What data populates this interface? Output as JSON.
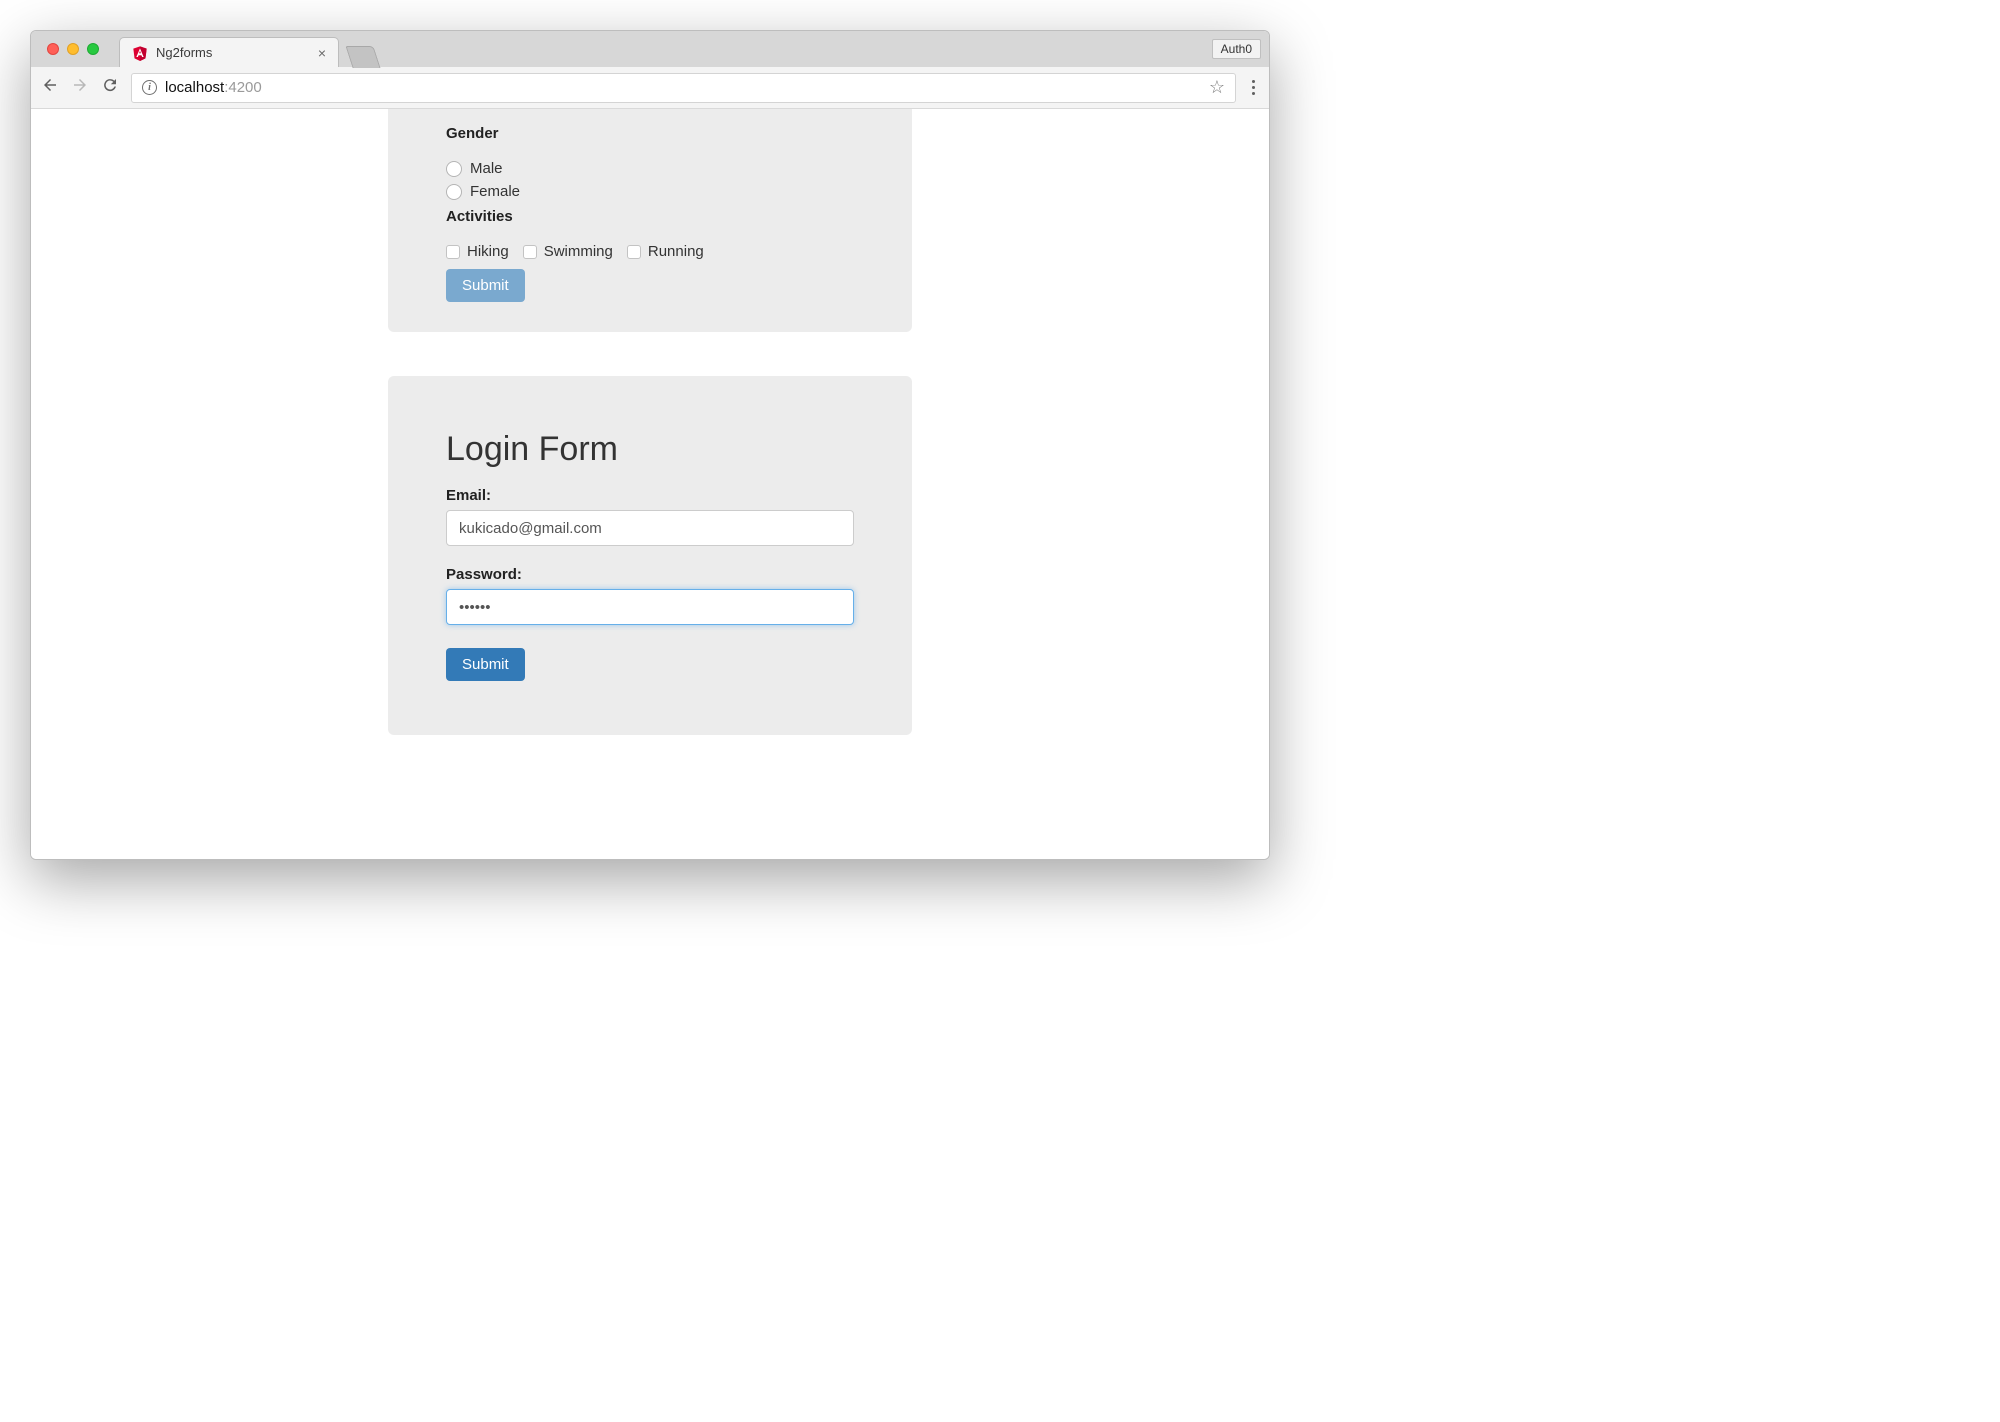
{
  "browser": {
    "tab_title": "Ng2forms",
    "auth_button": "Auth0",
    "url_host": "localhost",
    "url_path": ":4200"
  },
  "upper_form": {
    "gender_label": "Gender",
    "gender_options": {
      "male": "Male",
      "female": "Female"
    },
    "activities_label": "Activities",
    "activities": {
      "hiking": "Hiking",
      "swimming": "Swimming",
      "running": "Running"
    },
    "submit_label": "Submit"
  },
  "login_form": {
    "title": "Login Form",
    "email_label": "Email:",
    "email_value": "kukicado@gmail.com",
    "password_label": "Password:",
    "password_value": "••••••",
    "submit_label": "Submit"
  }
}
